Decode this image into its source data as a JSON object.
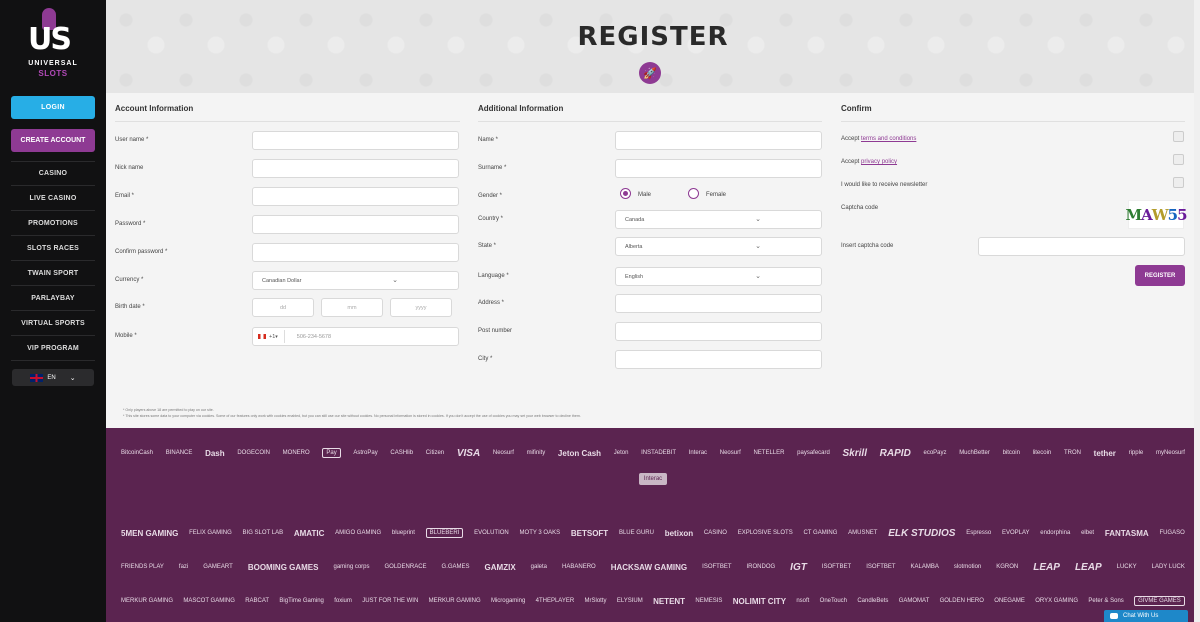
{
  "brand": {
    "mark": "US",
    "line1": "UNIVERSAL",
    "line2": "SLOTS"
  },
  "sidebar": {
    "login": "LOGIN",
    "create_account": "CREATE ACCOUNT",
    "items": [
      "CASINO",
      "LIVE CASINO",
      "PROMOTIONS",
      "SLOTS RACES",
      "TWAIN SPORT",
      "PARLAYBAY",
      "VIRTUAL SPORTS",
      "VIP PROGRAM"
    ],
    "language": "EN"
  },
  "page": {
    "title": "REGISTER",
    "rocket_icon": "rocket-icon"
  },
  "account": {
    "heading": "Account Information",
    "username_label": "User name *",
    "nickname_label": "Nick name",
    "email_label": "Email *",
    "password_label": "Password *",
    "confirm_password_label": "Confirm password *",
    "currency_label": "Currency *",
    "currency_value": "Canadian Dollar",
    "birth_label": "Birth date *",
    "dd": "dd",
    "mm": "mm",
    "yyyy": "yyyy",
    "mobile_label": "Mobile *",
    "mobile_code": "+1",
    "mobile_placeholder": "506-234-5678"
  },
  "additional": {
    "heading": "Additional Information",
    "name_label": "Name *",
    "surname_label": "Surname *",
    "gender_label": "Gender *",
    "male": "Male",
    "female": "Female",
    "country_label": "Country *",
    "country_value": "Canada",
    "state_label": "State *",
    "state_value": "Alberta",
    "language_label": "Language *",
    "language_value": "English",
    "address_label": "Address *",
    "postnumber_label": "Post number",
    "city_label": "City *"
  },
  "confirm": {
    "heading": "Confirm",
    "accept_prefix": "Accept ",
    "terms_link": "terms and conditions",
    "privacy_link": "privacy policy",
    "newsletter": "I would like to receive newsletter",
    "captcha_label": "Captcha code",
    "captcha_text": [
      "M",
      "A",
      "W",
      "5",
      "5"
    ],
    "insert_captcha_label": "Insert captcha code",
    "register": "REGISTER"
  },
  "notes": [
    "* Only players above 18 are permitted to play on our site.",
    "* This site stores some data to your computer via cookies. Some of our features only work with cookies enabled, but you can still use our site without cookies. No personal information is stored in cookies. If you don't accept the use of cookies you may set your web browser to decline them."
  ],
  "payments_row1": [
    "BitcoinCash",
    "BINANCE",
    "Dash",
    "DOGECOIN",
    "MONERO",
    "Pay",
    "AstroPay",
    "CASHlib",
    "Citizen",
    "VISA",
    "Neosurf",
    "mifinity",
    "Jeton Cash",
    "Jeton",
    "INSTADEBIT",
    "Interac",
    "Neosurf",
    "NETELLER",
    "paysafecard",
    "Skrill",
    "RAPID",
    "ecoPayz",
    "MuchBetter",
    "bitcoin",
    "litecoin",
    "TRON",
    "tether",
    "ripple",
    "myNeosurf"
  ],
  "payments_row2": [
    "Interac"
  ],
  "providers_row1": [
    "5MEN GAMING",
    "FELIX GAMING",
    "BIG SLOT LAB",
    "AMATIC",
    "AMIGO GAMING",
    "blueprint",
    "BLUEBERI",
    "EVOLUTION",
    "MOTY 3 OAKS",
    "BETSOFT",
    "BLUE GURU",
    "betixon",
    "CASINO",
    "EXPLOSIVE SLOTS",
    "CT GAMING",
    "AMUSNET",
    "ELK STUDIOS",
    "Espresso",
    "EVOPLAY",
    "endorphina",
    "elbet",
    "FANTASMA",
    "FUGASO"
  ],
  "providers_row2": [
    "FRIENDS PLAY",
    "fazi",
    "GAMEART",
    "BOOMING GAMES",
    "gaming corps",
    "GOLDENRACE",
    "G.GAMES",
    "GAMZIX",
    "galeta",
    "HABANERO",
    "HACKSAW GAMING",
    "ISOFTBET",
    "IRONDOG",
    "IGT",
    "ISOFTBET",
    "ISOFTBET",
    "KALAMBA",
    "slotmotion",
    "KGRON",
    "LEAP",
    "LEAP",
    "LUCKY",
    "LADY LUCK"
  ],
  "providers_row3": [
    "MERKUR GAMING",
    "MASCOT GAMING",
    "RABCAT",
    "BigTime Gaming",
    "foxium",
    "JUST FOR THE WIN",
    "MERKUR GAMING",
    "Microgaming",
    "4THEPLAYER",
    "MrSlotty",
    "ELYSIUM",
    "NETENT",
    "NEMESIS",
    "NOLIMIT CITY",
    "nsoft",
    "OneTouch",
    "CandleBets",
    "GAMOMAT",
    "GOLDEN HERO",
    "ONEGAME",
    "ORYX GAMING",
    "Peter & Sons",
    "GIVME GAMES"
  ],
  "chat": {
    "label": "Chat With Us"
  }
}
